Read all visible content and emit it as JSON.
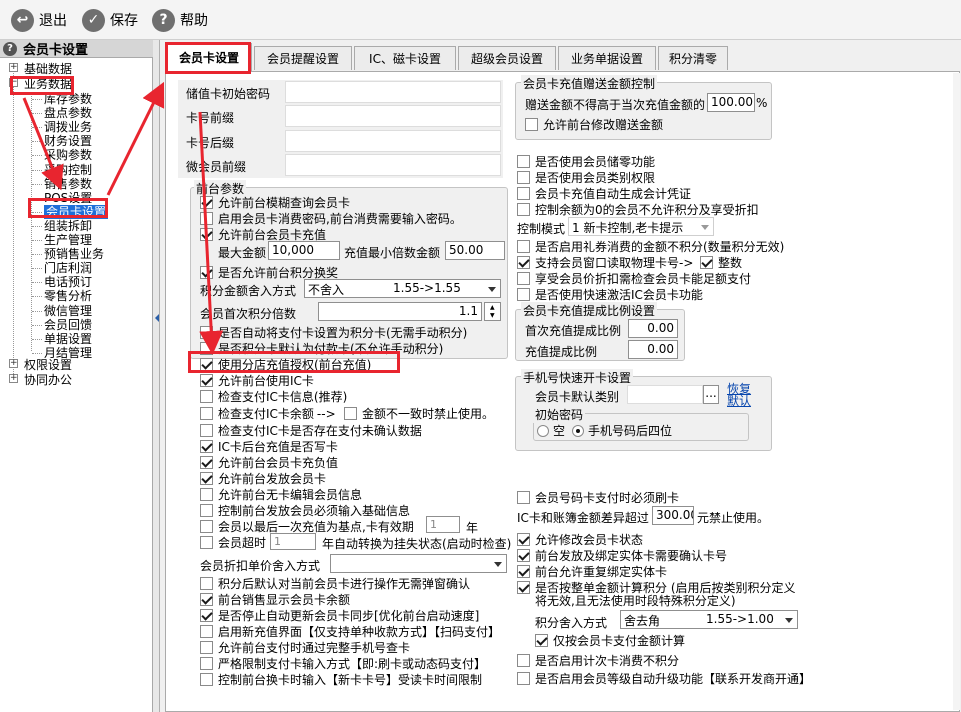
{
  "toolbar": {
    "exit": "退出",
    "save": "保存",
    "help": "帮助"
  },
  "sidebar": {
    "title": "会员卡设置",
    "basic": "基础数据",
    "business": "业务数据",
    "items": [
      "库存参数",
      "盘点参数",
      "调拨业务",
      "财务设置",
      "采购参数",
      "采购控制",
      "销售参数",
      "POS设置",
      "会员卡设置",
      "组装拆卸",
      "生产管理",
      "预销售业务",
      "门店利润",
      "电话预订",
      "零售分析",
      "微信管理",
      "会员回馈",
      "单据设置",
      "月结管理"
    ],
    "permissions": "权限设置",
    "office": "协同办公"
  },
  "tabs": [
    "会员卡设置",
    "会员提醒设置",
    "IC、磁卡设置",
    "超级会员设置",
    "业务单据设置",
    "积分清零"
  ],
  "fields": {
    "card_init_pwd": "储值卡初始密码",
    "card_prefix": "卡号前缀",
    "card_suffix": "卡号后缀",
    "wx_prefix": "微会员前缀"
  },
  "front": {
    "title": "前台参数",
    "c1": "允许前台模糊查询会员卡",
    "c2": "启用会员卡消费密码,前台消费需要输入密码。",
    "c3": "允许前台会员卡充值",
    "max_amount_label": "最大金额",
    "max_amount": "10,000",
    "min_multiple_label": "充值最小倍数金额",
    "min_multiple": "50.00",
    "c4": "是否允许前台积分换奖",
    "round_label": "积分金额舍入方式",
    "round_value": "不舍入",
    "round_hint": "1.55->1.55",
    "first_multi_label": "会员首次积分倍数",
    "first_multi": "1.1",
    "c5": "是否自动将支付卡设置为积分卡(无需手动积分)",
    "c6": "是否积分卡默认为付款卡(不允许手动积分)",
    "c7": "使用分店充值授权(前台充值)",
    "c8": "允许前台使用IC卡",
    "c9": "检查支付IC卡信息(推荐)",
    "c10": "检查支付IC卡余额",
    "c10b": "金额不一致时禁止使用。",
    "c10_arrow": "-->",
    "c11": "检查支付IC卡是否存在支付未确认数据",
    "c12": "IC卡后台充值是否写卡",
    "c13": "允许前台会员卡充负值",
    "c14": "允许前台发放会员卡",
    "c15": "允许前台无卡编辑会员信息",
    "c16": "控制前台发放会员必须输入基础信息",
    "c17": "会员以最后一次充值为基点,卡有效期",
    "c17_unit": "年",
    "c17_val": "1",
    "c18": "会员超时",
    "c18_val": "1",
    "c18_tail": "年自动转换为挂失状态(启动时检查)",
    "discount_label": "会员折扣单价舍入方式",
    "c19": "积分后默认对当前会员卡进行操作无需弹窗确认",
    "c20": "前台销售显示会员卡余额",
    "c21": "是否停止自动更新会员卡同步[优化前台启动速度]",
    "c22": "启用新充值界面【仅支持单种收款方式】【扫码支付】",
    "c23": "允许前台支付时通过完整手机号查卡",
    "c24": "严格限制支付卡输入方式【即:刷卡或动态码支付】",
    "c25": "控制前台换卡时输入【新卡卡号】受读卡时间限制"
  },
  "gift": {
    "title": "会员卡充值赠送金额控制",
    "limit_label": "赠送金额不得高于当次充值金额的",
    "limit_value": "100.00",
    "limit_unit": "%",
    "allow_edit": "允许前台修改赠送金额"
  },
  "right": {
    "r1": "是否使用会员储零功能",
    "r2": "是否使用会员类别权限",
    "r3": "会员卡充值自动生成会计凭证",
    "r4": "控制余额为0的会员不允许积分及享受折扣",
    "mode_label": "控制模式",
    "mode_value": "1 新卡控制,老卡提示",
    "r5": "是否启用礼券消费的金额不积分(数量积分无效)",
    "r6": "支持会员窗口读取物理卡号->",
    "r6b": "整数",
    "r7": "享受会员价折扣需检查会员卡能足额支付",
    "r8": "是否使用快速激活IC会员卡功能"
  },
  "ratio": {
    "title": "会员卡充值提成比例设置",
    "first_label": "首次充值提成比例",
    "first_value": "0.00",
    "recharge_label": "充值提成比例",
    "recharge_value": "0.00"
  },
  "phone": {
    "title": "手机号快速开卡设置",
    "type_label": "会员卡默认类别",
    "btn": "...",
    "link1": "恢复",
    "link2": "默认",
    "pwd_title": "初始密码",
    "opt_empty": "空",
    "opt_last4": "手机号码后四位"
  },
  "lower": {
    "l1": "会员号码卡支付时必须刷卡",
    "diff_label": "IC卡和账簿金额差异超过",
    "diff_value": "300.00",
    "diff_tail": "元禁止使用。",
    "l2": "允许修改会员卡状态",
    "l3": "前台发放及绑定实体卡需要确认卡号",
    "l4": "前台允许重复绑定实体卡",
    "l5a": "是否按整单金额计算积分 (启用后按类别积分定义",
    "l5b": "将无效,且无法使用时段特殊积分定义)",
    "round_label": "积分舍入方式",
    "round_value": "舍去角",
    "round_hint": "1.55->1.00",
    "l6": "仅按会员卡支付金额计算",
    "l7": "是否启用计次卡消费不积分",
    "l8": "是否启用会员等级自动升级功能【联系开发商开通】"
  }
}
